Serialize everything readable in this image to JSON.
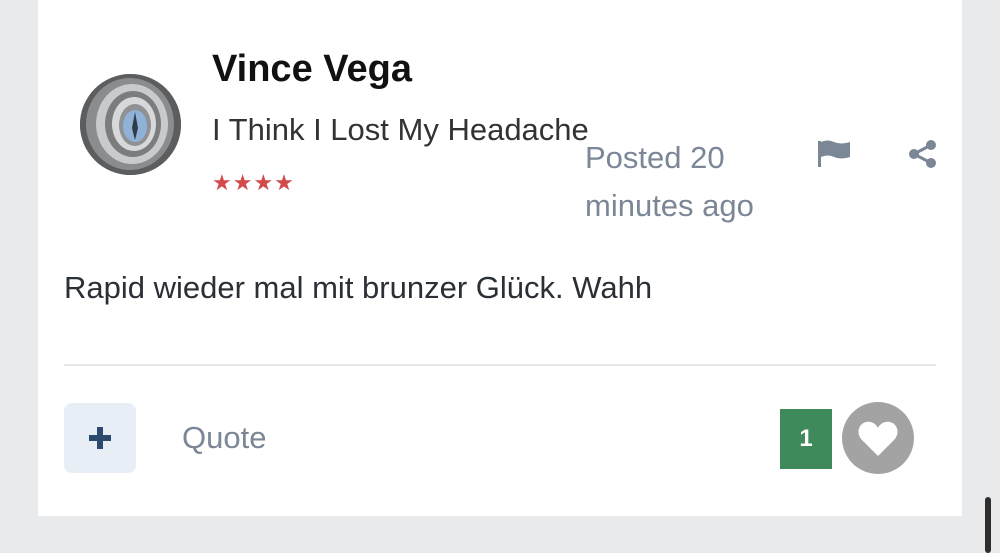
{
  "post": {
    "author": "Vince Vega",
    "user_title": "I Think I Lost My Headache",
    "stars": "★★★★",
    "posted": "Posted 20 minutes ago",
    "content": "Rapid wieder mal mit brunzer Glück. Wahh"
  },
  "actions": {
    "quote_label": "Quote",
    "plus_icon": "plus-icon",
    "flag_icon": "flag-icon",
    "share_icon": "share-icon",
    "like_icon": "heart-icon"
  },
  "reactions": {
    "count": "1"
  },
  "colors": {
    "reaction_count_bg": "#3f8a5a",
    "plus_button_bg": "#e8eef6",
    "stars": "#d24a4a",
    "muted_text": "#7b8696"
  }
}
